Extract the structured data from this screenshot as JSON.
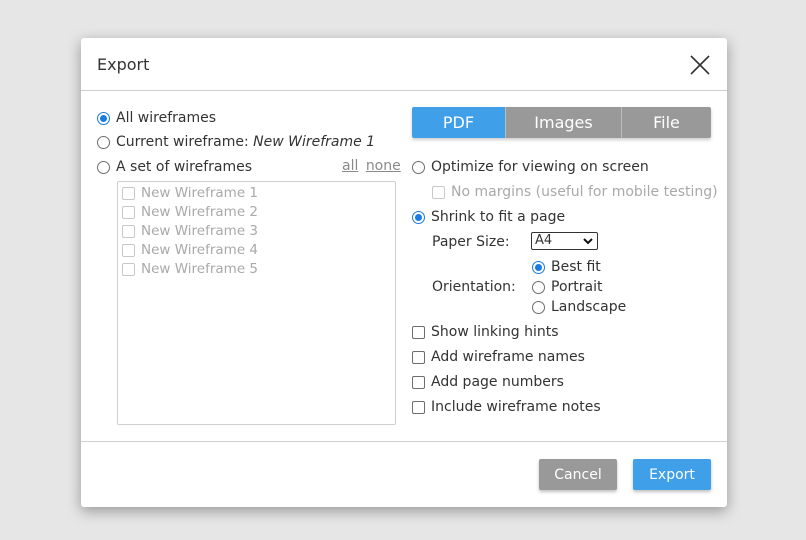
{
  "dialog": {
    "title": "Export",
    "close_icon": "close-icon"
  },
  "left": {
    "scope_options": [
      {
        "label": "All wireframes",
        "selected": true
      },
      {
        "label": "Current wireframe:",
        "extra": "New Wireframe 1",
        "selected": false
      },
      {
        "label": "A set of wireframes",
        "selected": false
      }
    ],
    "select_all": "all",
    "select_none": "none",
    "wireframes": [
      "New Wireframe 1",
      "New Wireframe 2",
      "New Wireframe 3",
      "New Wireframe 4",
      "New Wireframe 5"
    ]
  },
  "tabs": {
    "items": [
      "PDF",
      "Images",
      "File"
    ],
    "active": "PDF"
  },
  "pdf": {
    "optimize_label": "Optimize for viewing on screen",
    "no_margins_label": "No margins (useful for mobile testing)",
    "shrink_label": "Shrink to fit a page",
    "paper_size_label": "Paper Size:",
    "paper_size_value": "A4",
    "orientation_label": "Orientation:",
    "orientation_options": [
      "Best fit",
      "Portrait",
      "Landscape"
    ],
    "orientation_selected": "Best fit",
    "checkboxes": [
      "Show linking hints",
      "Add wireframe names",
      "Add page numbers",
      "Include wireframe notes"
    ]
  },
  "footer": {
    "cancel_label": "Cancel",
    "export_label": "Export"
  },
  "colors": {
    "accent": "#3f9fe8",
    "button_gray": "#999999",
    "backdrop": "#e6e6e6"
  }
}
